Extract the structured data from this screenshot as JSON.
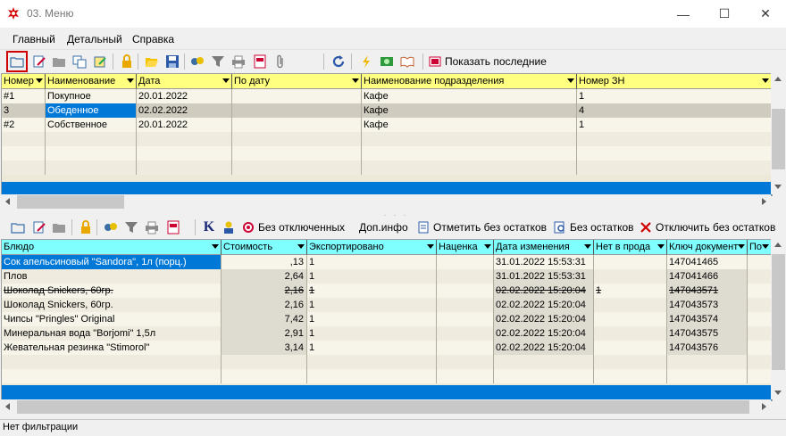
{
  "window": {
    "title": "03. Меню",
    "minimize": "—",
    "maximize": "☐",
    "close": "✕"
  },
  "menu": [
    "Главный",
    "Детальный",
    "Справка"
  ],
  "toolbar1": {
    "show_last_label": "Показать последние"
  },
  "toolbar2": {
    "without_disabled": "Без отключенных",
    "extra_info": "Доп.инфо",
    "mark_no_stock": "Отметить без остатков",
    "no_stock": "Без остатков",
    "disable_no_stock": "Отключить без остатков"
  },
  "top_grid": {
    "columns": [
      "Номер",
      "Наименование",
      "Дата",
      "По дату",
      "Наименование подразделения",
      "Номер ЗН"
    ],
    "rows": [
      [
        "#1",
        "Покупное",
        "20.01.2022",
        "",
        "Кафе",
        "1"
      ],
      [
        "3",
        "Обеденное",
        "02.02.2022",
        "",
        "Кафе",
        "4"
      ],
      [
        "#2",
        "Собственное",
        "20.01.2022",
        "",
        "Кафе",
        "1"
      ]
    ]
  },
  "bottom_grid": {
    "columns": [
      "Блюдо",
      "Стоимость",
      "Экспортировано",
      "Наценка",
      "Дата изменения",
      "Нет в прода",
      "Ключ документ",
      "По"
    ],
    "rows": [
      [
        "Сок апельсиновый \"Sandora\", 1л (порц.)",
        ",13",
        "1",
        "",
        "31.01.2022 15:53:31",
        "",
        "147041465",
        ""
      ],
      [
        "Плов",
        "2,64",
        "1",
        "",
        "31.01.2022 15:53:31",
        "",
        "147041466",
        ""
      ],
      [
        "Шоколад Snickers, 60гр.",
        "2,16",
        "1",
        "",
        "02.02.2022 15:20:04",
        "1",
        "147043571",
        ""
      ],
      [
        "Шоколад Snickers, 60гр.",
        "2,16",
        "1",
        "",
        "02.02.2022 15:20:04",
        "",
        "147043573",
        ""
      ],
      [
        "Чипсы \"Pringles\" Original",
        "7,42",
        "1",
        "",
        "02.02.2022 15:20:04",
        "",
        "147043574",
        ""
      ],
      [
        "Минеральная вода \"Borjomi\" 1,5л",
        "2,91",
        "1",
        "",
        "02.02.2022 15:20:04",
        "",
        "147043575",
        ""
      ],
      [
        "Жевательная резинка \"Stimorol\"",
        "3,14",
        "1",
        "",
        "02.02.2022 15:20:04",
        "",
        "147043576",
        ""
      ]
    ]
  },
  "status": "Нет фильтрации",
  "colors": {
    "header_yellow": "#ffff80",
    "header_cyan": "#80ffff",
    "selection": "#0078d7",
    "footer_blue": "#0078d7",
    "row_bg": "#f4f2e8"
  }
}
